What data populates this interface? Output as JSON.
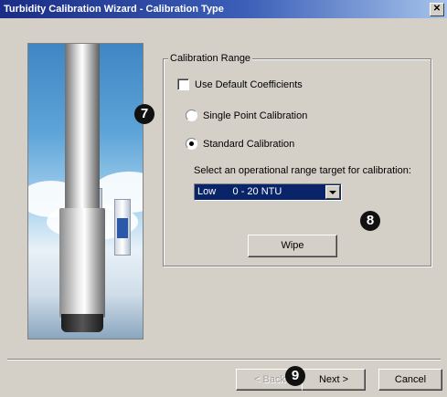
{
  "window": {
    "title": "Turbidity Calibration Wizard - Calibration Type",
    "close_label": "✕"
  },
  "group": {
    "legend": "Calibration Range",
    "use_default": {
      "label": "Use Default Coefficients",
      "checked": false
    },
    "radios": [
      {
        "label": "Single Point Calibration",
        "checked": false
      },
      {
        "label": "Standard Calibration",
        "checked": true
      }
    ],
    "select_label": "Select an operational range target for calibration:",
    "range_dropdown": {
      "value": "Low      0 - 20 NTU"
    },
    "wipe_label": "Wipe"
  },
  "footer": {
    "back_label": "< Back",
    "next_label": "Next >",
    "cancel_label": "Cancel"
  },
  "annotations": {
    "b7": "7",
    "b8": "8",
    "b9": "9"
  },
  "icons": [
    "close-icon",
    "dropdown-arrow-icon"
  ]
}
